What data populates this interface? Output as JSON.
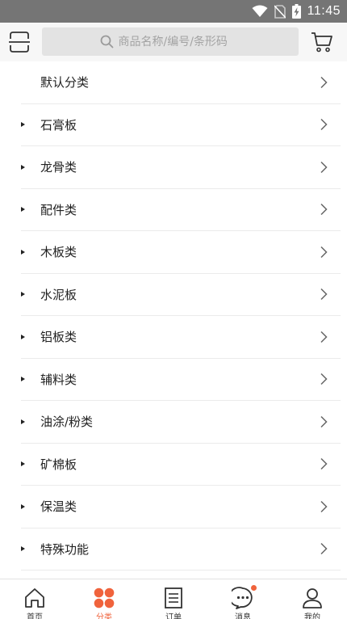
{
  "status_bar": {
    "time": "11:45",
    "icons": [
      "wifi-icon",
      "no-sim-icon",
      "battery-charging-icon"
    ]
  },
  "header": {
    "scan_icon": "scan-icon",
    "search_placeholder": "商品名称/编号/条形码",
    "cart_icon": "cart-icon"
  },
  "categories": [
    {
      "label": "默认分类",
      "expandable": false
    },
    {
      "label": "石膏板",
      "expandable": true
    },
    {
      "label": "龙骨类",
      "expandable": true
    },
    {
      "label": "配件类",
      "expandable": true
    },
    {
      "label": "木板类",
      "expandable": true
    },
    {
      "label": "水泥板",
      "expandable": true
    },
    {
      "label": "铝板类",
      "expandable": true
    },
    {
      "label": "辅料类",
      "expandable": true
    },
    {
      "label": "油涂/粉类",
      "expandable": true
    },
    {
      "label": "矿棉板",
      "expandable": true
    },
    {
      "label": "保温类",
      "expandable": true
    },
    {
      "label": "特殊功能",
      "expandable": true
    }
  ],
  "tabs": [
    {
      "label": "首页",
      "icon": "home-icon",
      "active": false
    },
    {
      "label": "分类",
      "icon": "category-icon",
      "active": true
    },
    {
      "label": "订单",
      "icon": "order-icon",
      "active": false
    },
    {
      "label": "消息",
      "icon": "message-icon",
      "active": false,
      "badge": true
    },
    {
      "label": "我的",
      "icon": "profile-icon",
      "active": false
    }
  ],
  "colors": {
    "accent": "#f0633c",
    "status_bar": "#757575",
    "header_bg": "#f7f7f7",
    "search_bg": "#e3e3e3"
  }
}
